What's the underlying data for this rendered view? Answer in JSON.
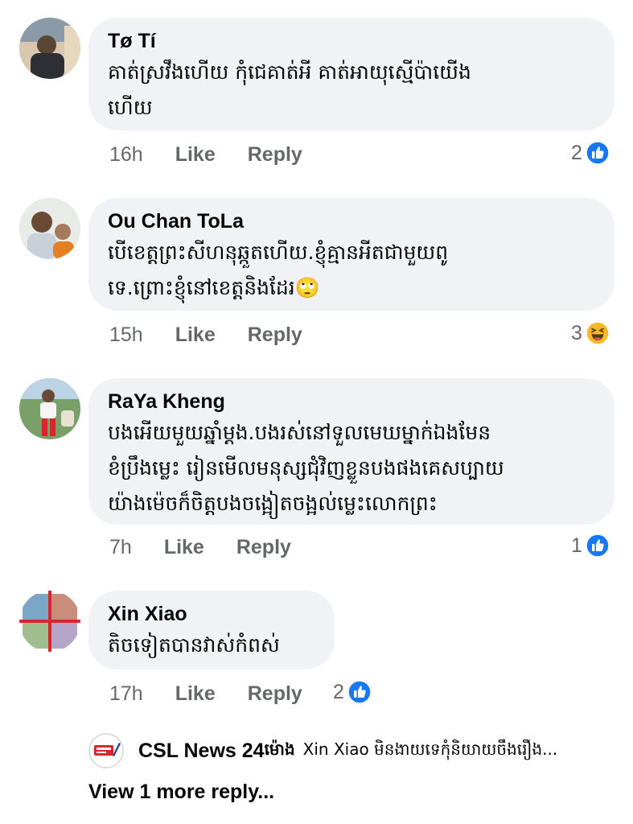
{
  "comments": [
    {
      "author": "Tø Tí",
      "text": "គាត់ស្រវឹងហើយ កុំជេគាត់អី គាត់អាយុស្មើប៉ាយើង\nហើយ",
      "time": "16h",
      "like_label": "Like",
      "reply_label": "Reply",
      "reaction_count": "2",
      "reaction_icon": "like-reaction-icon"
    },
    {
      "author": "Ou Chan ToLa",
      "text": "បើខេត្តព្រះសីហនុឆ្កួតហើយ.ខ្ញុំគ្មានអីតជាមួយពូ\nទេ.ព្រោះខ្ញុំនៅខេត្តនិងដែរ🙄",
      "time": "15h",
      "like_label": "Like",
      "reply_label": "Reply",
      "reaction_count": "3",
      "reaction_icon": "haha-reaction-icon"
    },
    {
      "author": "RaYa Kheng",
      "text": "បងអើយមួយឆ្នាំម្តង.បងរស់នៅទួលមេឃម្នាក់ឯងមែន\nខំប្រឹងម្លេះ រៀនមើលមនុស្សជុំវិញខ្លួនបងផងគេសប្បាយ\nយ៉ាងម៉េចក៏ចិត្តបងចង្អៀតចង្អល់ម្លេះលោកព្រះ",
      "time": "7h",
      "like_label": "Like",
      "reply_label": "Reply",
      "reaction_count": "1",
      "reaction_icon": "like-reaction-icon"
    },
    {
      "author": "Xin Xiao",
      "text": "តិចទៀតបានវាស់កំពស់",
      "time": "17h",
      "like_label": "Like",
      "reply_label": "Reply",
      "reaction_count": "2",
      "reaction_icon": "like-reaction-icon"
    }
  ],
  "reply_preview": {
    "author": "CSL News 24",
    "time": "ម៉ោង",
    "text": "Xin Xiao មិនងាយទេកុំនិយាយចឹងរឿង..."
  },
  "view_more_label": "View 1 more reply...",
  "colors": {
    "bubble": "#f0f2f5",
    "meta_text": "#65676b",
    "like_blue": "#1877f2",
    "haha_yellow": "#f7b928"
  }
}
